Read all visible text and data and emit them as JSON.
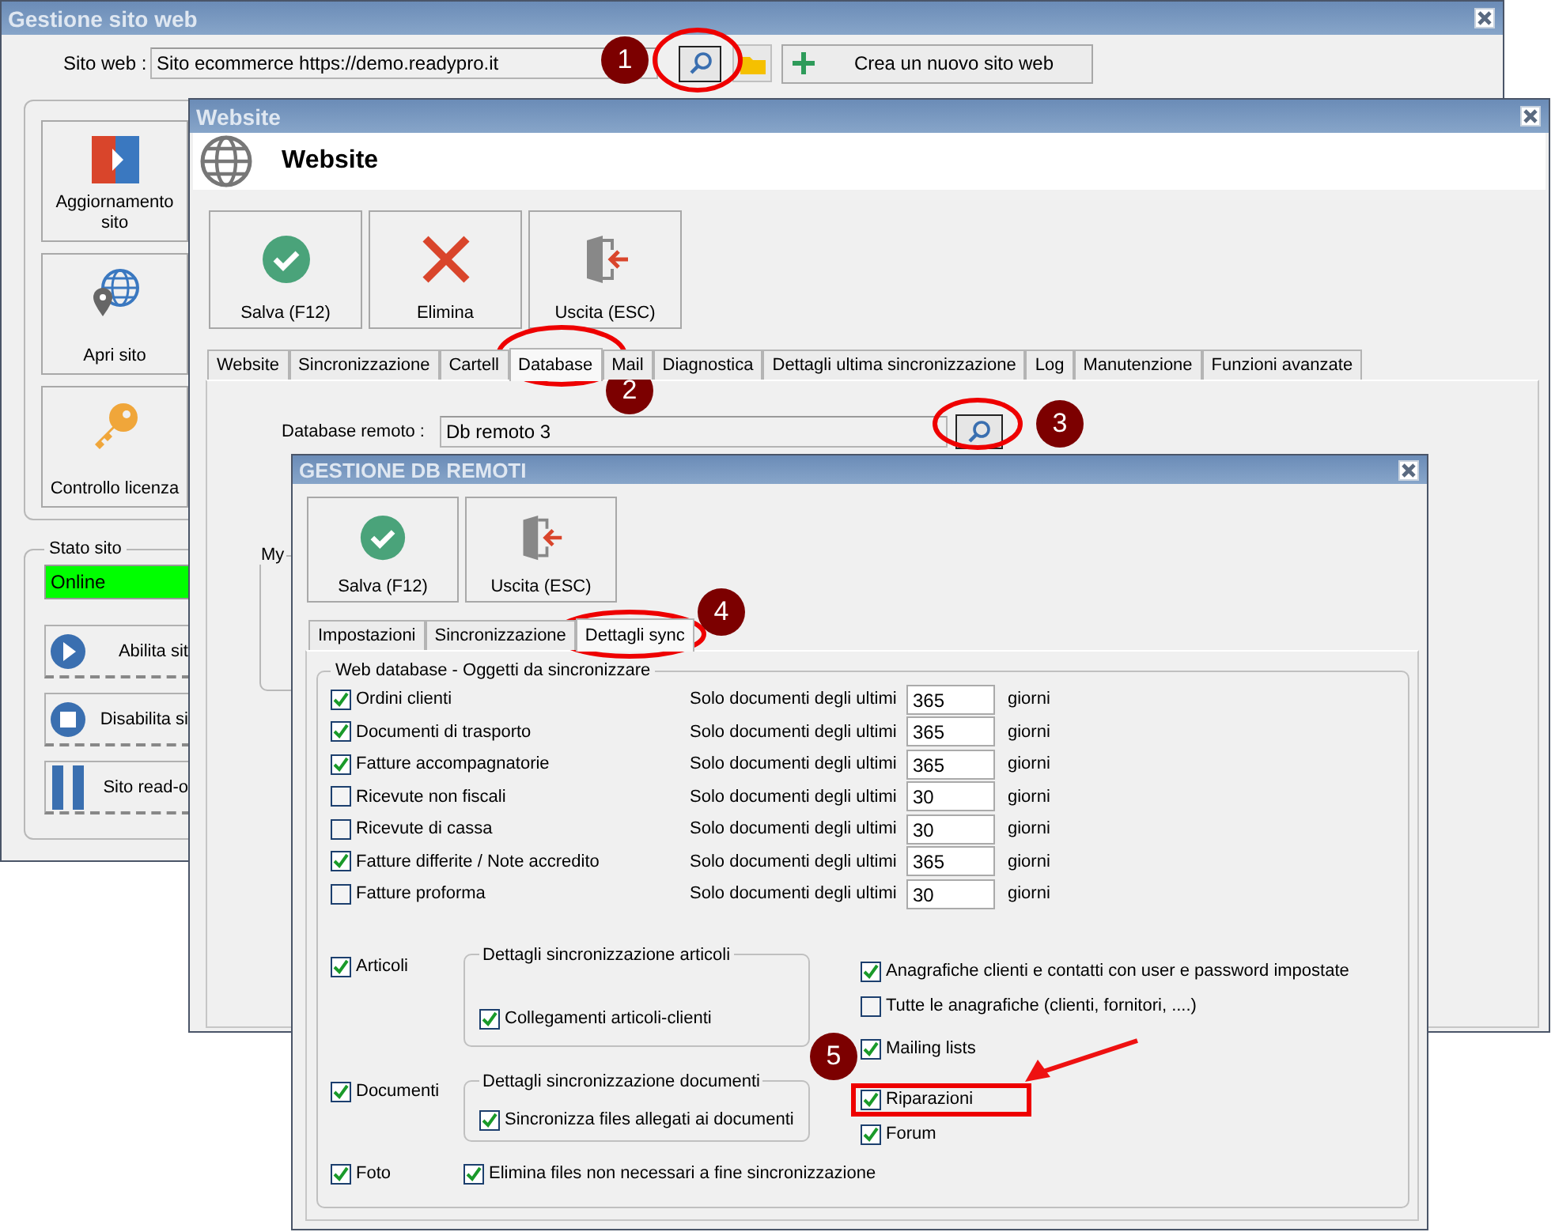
{
  "main_window": {
    "title": "Gestione sito web",
    "site_label": "Sito web :",
    "site_value": "Sito ecommerce https://demo.readypro.it",
    "new_site_button": "Crea un nuovo sito web",
    "side_buttons": [
      {
        "kind": "update",
        "label": "Aggiornamento sito"
      },
      {
        "kind": "open",
        "label": "Apri sito"
      },
      {
        "kind": "license",
        "label": "Controllo licenza"
      }
    ],
    "status_group": {
      "title": "Stato sito",
      "status": "Online",
      "online": true,
      "buttons": [
        {
          "kind": "play",
          "label": "Abilita sit"
        },
        {
          "kind": "stop",
          "label": "Disabilita si"
        },
        {
          "kind": "pause",
          "label": "Sito read-o"
        }
      ]
    }
  },
  "website_window": {
    "title": "Website",
    "heading": "Website",
    "toolbar": [
      {
        "kind": "save",
        "label": "Salva (F12)"
      },
      {
        "kind": "delete",
        "label": "Elimina"
      },
      {
        "kind": "exit",
        "label": "Uscita (ESC)"
      }
    ],
    "tabs": [
      {
        "label": "Website",
        "selected": false
      },
      {
        "label": "Sincronizzazione",
        "selected": false
      },
      {
        "label": "Cartell",
        "selected": false
      },
      {
        "label": "Database",
        "selected": true
      },
      {
        "label": "Mail",
        "selected": false
      },
      {
        "label": "Diagnostica",
        "selected": false
      },
      {
        "label": "Dettagli ultima sincronizzazione",
        "selected": false
      },
      {
        "label": "Log",
        "selected": false
      },
      {
        "label": "Manutenzione",
        "selected": false
      },
      {
        "label": "Funzioni avanzate",
        "selected": false
      }
    ],
    "remote_db_label": "Database remoto :",
    "remote_db_value": "Db remoto 3",
    "group_title": "My"
  },
  "db_window": {
    "title": "GESTIONE DB REMOTI",
    "toolbar": [
      {
        "kind": "save",
        "label": "Salva (F12)"
      },
      {
        "kind": "exit",
        "label": "Uscita (ESC)"
      }
    ],
    "tabs": [
      {
        "label": "Impostazioni",
        "selected": false
      },
      {
        "label": "Sincronizzazione",
        "selected": false
      },
      {
        "label": "Dettagli sync",
        "selected": true
      }
    ],
    "group_title": "Web database - Oggetti da sincronizzare",
    "documents": [
      {
        "label": "Ordini clienti",
        "checked": true,
        "prefix": "Solo documenti degli ultimi",
        "days": "365",
        "unit": "giorni"
      },
      {
        "label": "Documenti di trasporto",
        "checked": true,
        "prefix": "Solo documenti degli ultimi",
        "days": "365",
        "unit": "giorni"
      },
      {
        "label": "Fatture accompagnatorie",
        "checked": true,
        "prefix": "Solo documenti degli ultimi",
        "days": "365",
        "unit": "giorni"
      },
      {
        "label": "Ricevute non fiscali",
        "checked": false,
        "prefix": "Solo documenti degli ultimi",
        "days": "30",
        "unit": "giorni"
      },
      {
        "label": "Ricevute di cassa",
        "checked": false,
        "prefix": "Solo documenti degli ultimi",
        "days": "30",
        "unit": "giorni"
      },
      {
        "label": "Fatture differite / Note accredito",
        "checked": true,
        "prefix": "Solo documenti degli ultimi",
        "days": "365",
        "unit": "giorni"
      },
      {
        "label": "Fatture proforma",
        "checked": false,
        "prefix": "Solo documenti degli ultimi",
        "days": "30",
        "unit": "giorni"
      }
    ],
    "articles": {
      "label": "Articoli",
      "checked": true,
      "group_title": "Dettagli sincronizzazione articoli",
      "option": {
        "label": "Collegamenti articoli-clienti",
        "checked": true
      }
    },
    "documents_sync": {
      "label": "Documenti",
      "checked": true,
      "group_title": "Dettagli sincronizzazione documenti",
      "option": {
        "label": "Sincronizza files allegati ai documenti",
        "checked": true
      }
    },
    "photos": {
      "label": "Foto",
      "checked": true
    },
    "cleanup": {
      "label": "Elimina files non necessari a fine sincronizzazione",
      "checked": true
    },
    "other_objects": [
      {
        "label": "Anagrafiche clienti e contatti con user e password impostate",
        "checked": true,
        "highlighted": false
      },
      {
        "label": "Tutte le anagrafiche (clienti, fornitori, ....)",
        "checked": false,
        "highlighted": false
      },
      {
        "label": "Mailing lists",
        "checked": true,
        "highlighted": false
      },
      {
        "label": "Riparazioni",
        "checked": true,
        "highlighted": true
      },
      {
        "label": "Forum",
        "checked": true,
        "highlighted": false
      }
    ]
  },
  "annotations": [
    {
      "number": "1",
      "ring": true,
      "arrow": false
    },
    {
      "number": "2",
      "ring": true,
      "arrow": false
    },
    {
      "number": "3",
      "ring": true,
      "arrow": false
    },
    {
      "number": "4",
      "ring": true,
      "arrow": false
    },
    {
      "number": "5",
      "ring": false,
      "arrow": true
    }
  ]
}
